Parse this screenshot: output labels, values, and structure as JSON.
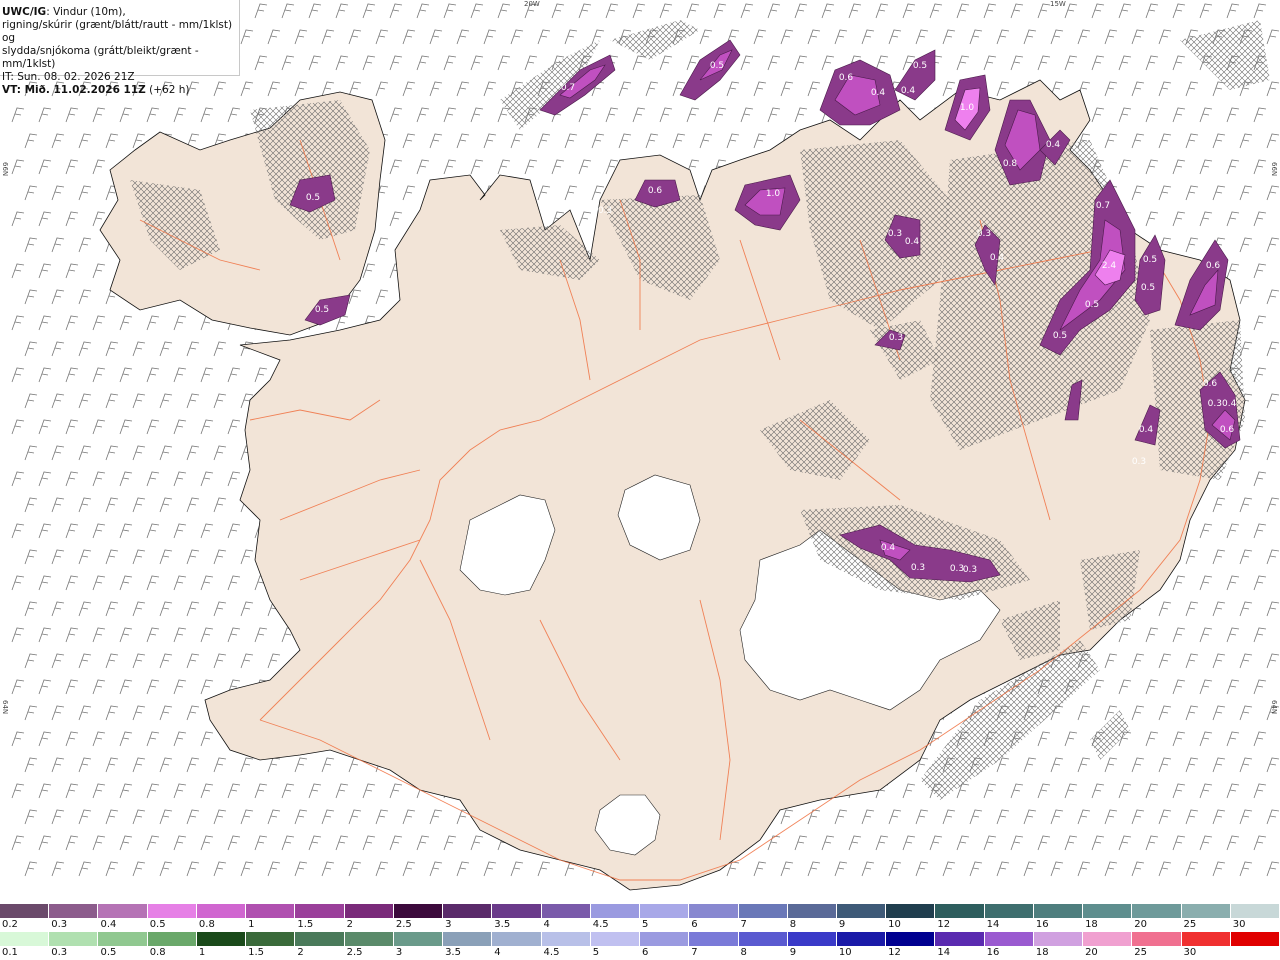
{
  "header": {
    "model_label": "UWC/IG",
    "line1_rest": ": Vindur (10m),",
    "line2": "rigning/skúrir (grænt/blátt/rautt - mm/1klst) og",
    "line3": "slydda/snjókoma (grátt/bleikt/grænt - mm/1klst)",
    "line4": "IT: Sun. 08. 02. 2026 21Z",
    "valid_label": "VT: Mið. 11.02.2026 11Z",
    "valid_offset": " (+62 h)"
  },
  "coords": {
    "top_left": "20W",
    "top_right": "15W",
    "left_top": "66N",
    "left_bottom": "64N",
    "right_top": "66N",
    "right_bottom": "64N"
  },
  "precip_labels": [
    {
      "text": "0.7"
    },
    {
      "text": "0.5"
    },
    {
      "text": "0.6"
    },
    {
      "text": "0.4"
    },
    {
      "text": "0.4"
    },
    {
      "text": "0.5"
    },
    {
      "text": "1.0"
    },
    {
      "text": "0.8"
    },
    {
      "text": "0.4"
    },
    {
      "text": "0.5"
    },
    {
      "text": "0.6"
    },
    {
      "text": "0.3"
    },
    {
      "text": "1.0"
    },
    {
      "text": "0.5"
    },
    {
      "text": "0.7"
    },
    {
      "text": "2.4"
    },
    {
      "text": "0.5"
    },
    {
      "text": "0.5"
    },
    {
      "text": "0.6"
    },
    {
      "text": "0.5"
    },
    {
      "text": "0.5"
    },
    {
      "text": "0.3"
    },
    {
      "text": "0.4"
    },
    {
      "text": "0.3"
    },
    {
      "text": "0.4"
    },
    {
      "text": "0.3"
    },
    {
      "text": "0.6"
    },
    {
      "text": "0.30.4"
    },
    {
      "text": "0.6"
    },
    {
      "text": "0.4"
    },
    {
      "text": "0.3"
    },
    {
      "text": "0.4"
    },
    {
      "text": "0.3"
    },
    {
      "text": "0.3"
    },
    {
      "text": "0.3"
    }
  ],
  "snow_scale": {
    "labels": [
      "0.2",
      "0.3",
      "0.4",
      "0.5",
      "0.8",
      "1",
      "1.5",
      "2",
      "2.5",
      "3",
      "3.5",
      "4",
      "4.5",
      "5",
      "6",
      "7",
      "8",
      "9",
      "10",
      "12",
      "14",
      "16",
      "18",
      "20",
      "25",
      "30"
    ],
    "colors": [
      "#6b4a6b",
      "#8c5c8c",
      "#b573b5",
      "#e680e6",
      "#d066d0",
      "#b050b0",
      "#9a3f9a",
      "#7a2a7a",
      "#3c0a3c",
      "#5a2a6a",
      "#6a3a8a",
      "#7a5aaa",
      "#9a9ae0",
      "#a8a8e8",
      "#8888d0",
      "#6a78b8",
      "#5a6a98",
      "#3e5a78",
      "#203e4e",
      "#2e5e5e",
      "#3e6e6e",
      "#4e7e7e",
      "#5e8e8e",
      "#6e9a9a",
      "#8aaeae",
      "#c8d8d8"
    ]
  },
  "rain_scale": {
    "labels": [
      "0.1",
      "0.3",
      "0.5",
      "0.8",
      "1",
      "1.5",
      "2",
      "2.5",
      "3",
      "3.5",
      "4",
      "4.5",
      "5",
      "6",
      "7",
      "8",
      "9",
      "10",
      "12",
      "14",
      "16",
      "18",
      "20",
      "25",
      "30"
    ],
    "colors": [
      "#d8f8d8",
      "#b0e0b0",
      "#90c890",
      "#6aa86a",
      "#1a4a1a",
      "#3a6a3a",
      "#4a7a5a",
      "#5a8a6a",
      "#6a9a8a",
      "#8aa0b8",
      "#a0b0d0",
      "#b8c0e8",
      "#c0c0f0",
      "#9a9ae0",
      "#7a7ad8",
      "#5a5ad0",
      "#3a3ac8",
      "#1a1aa8",
      "#000090",
      "#5a2ab0",
      "#9a5ad0",
      "#d0a0e0",
      "#f0a0d0",
      "#f07090",
      "#f03030",
      "#e00000"
    ]
  }
}
